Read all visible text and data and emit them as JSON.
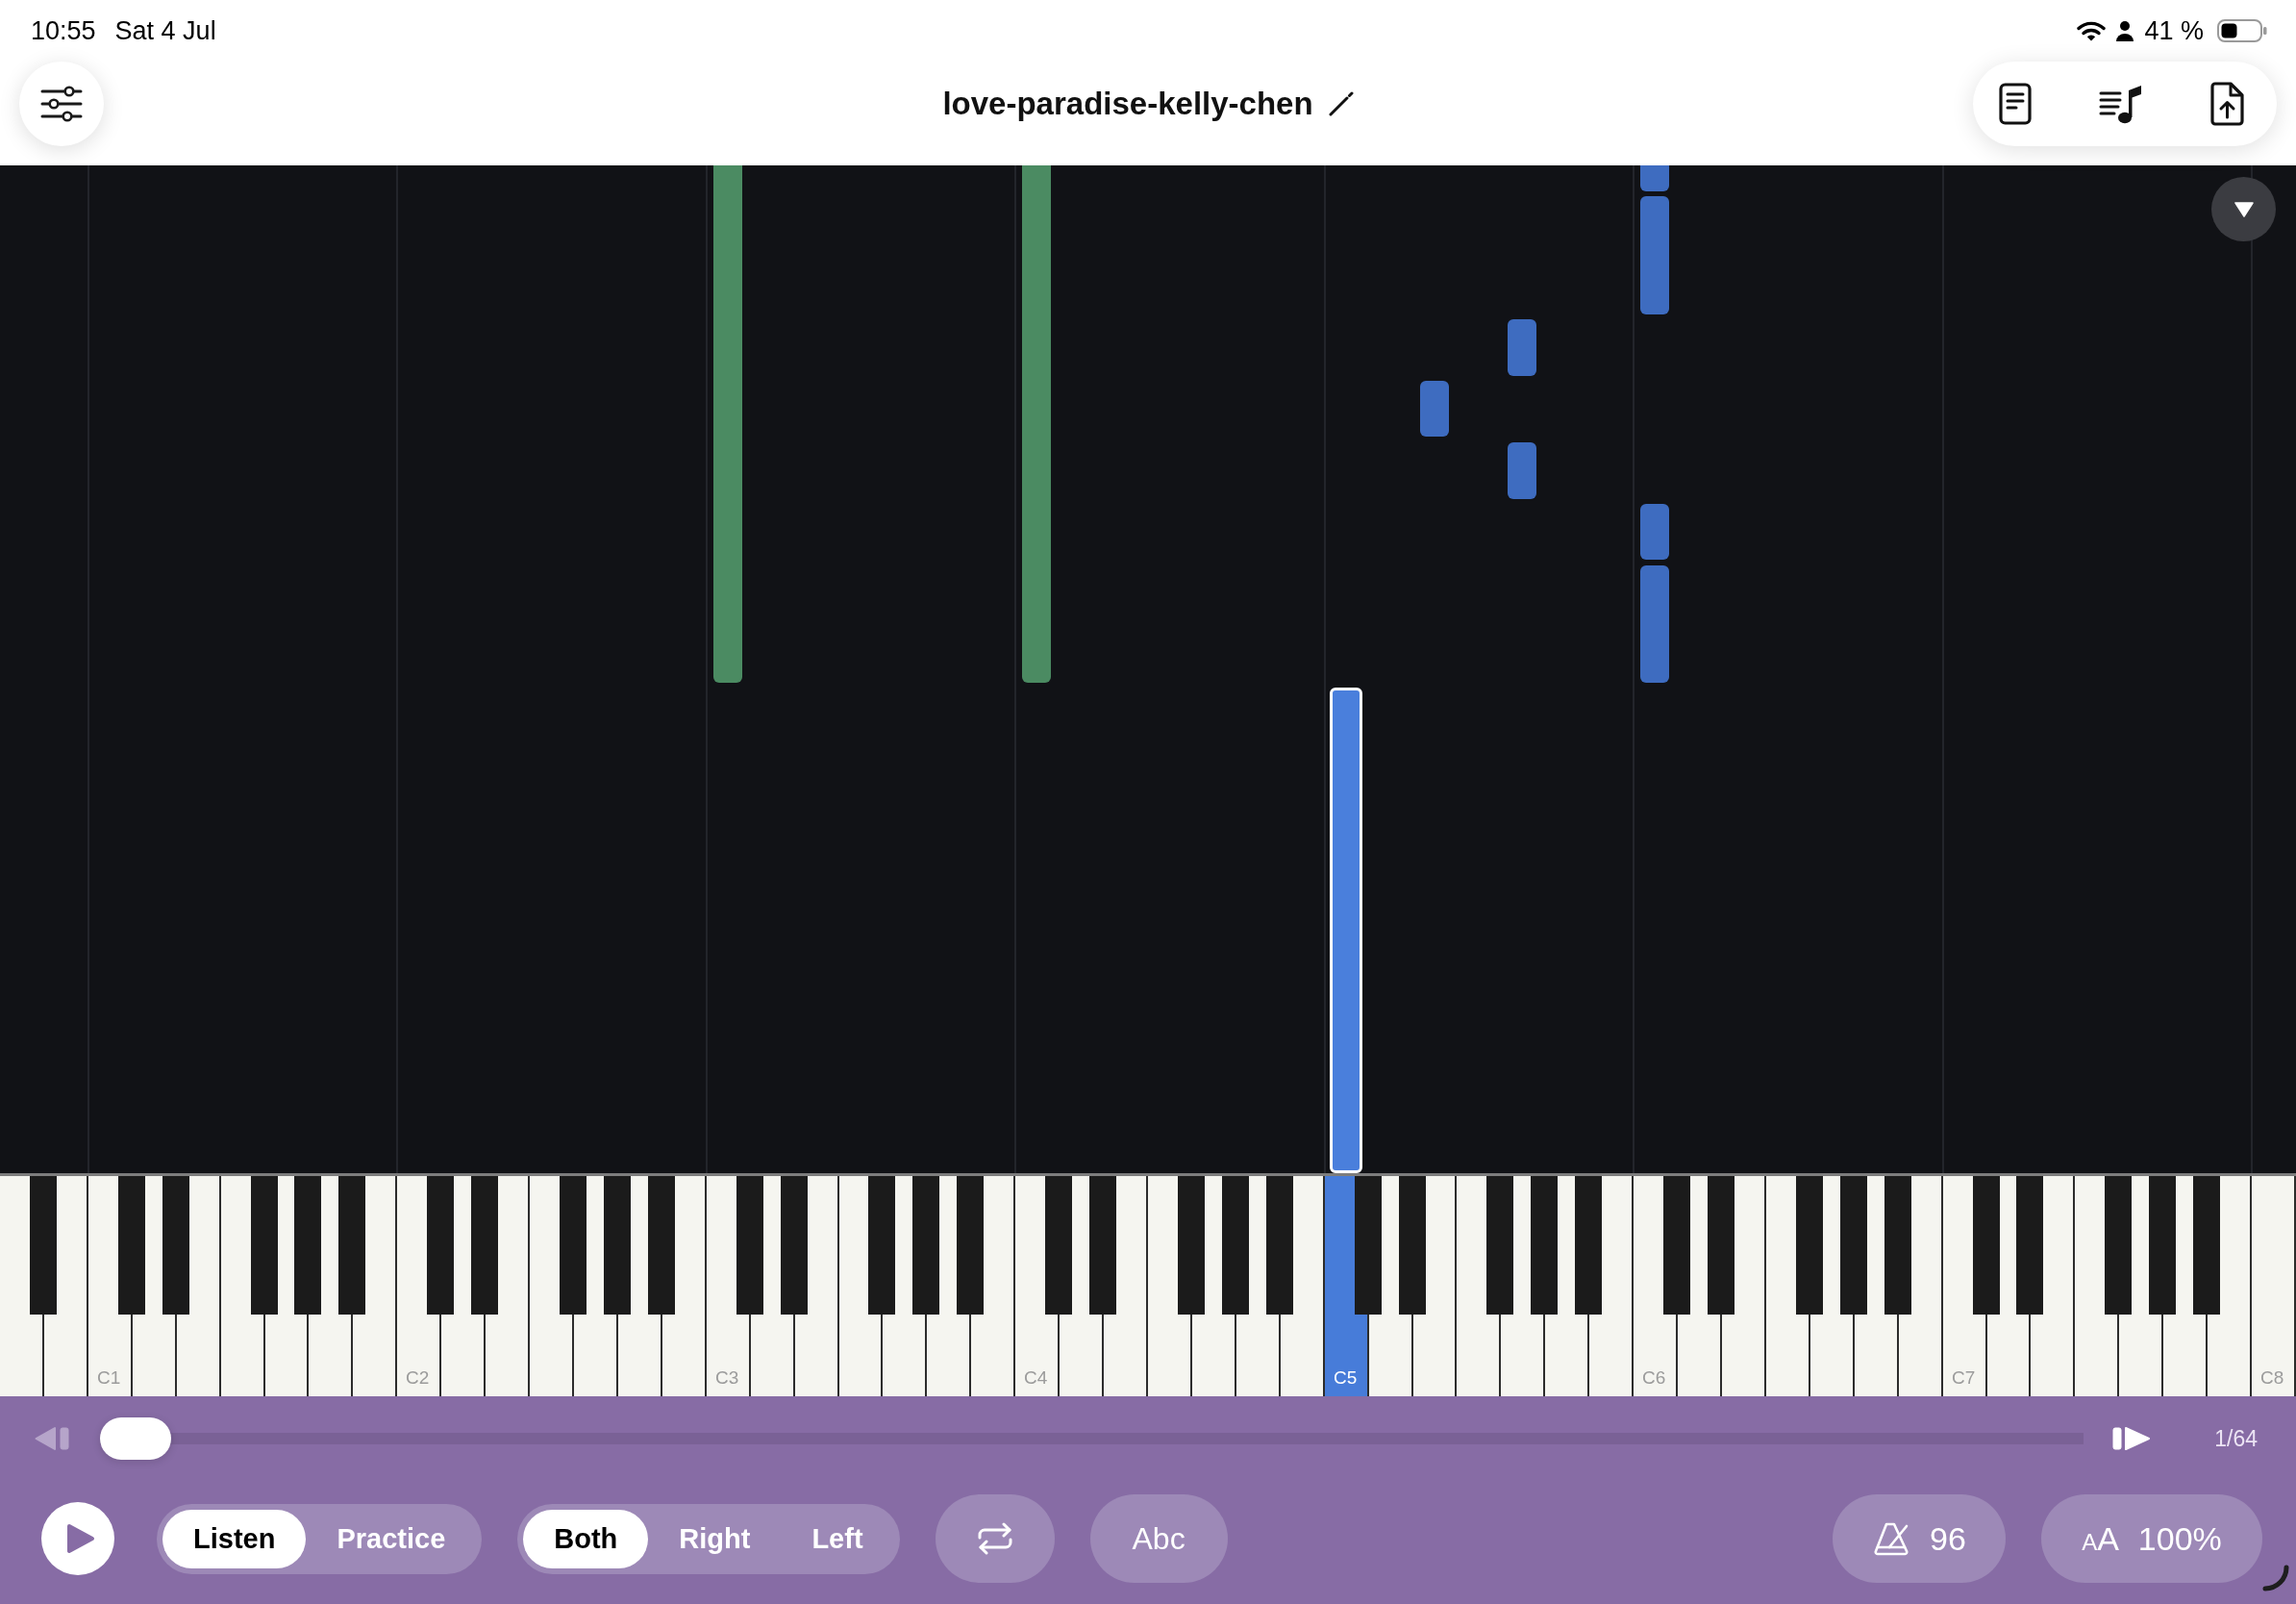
{
  "status_bar": {
    "time": "10:55",
    "date": "Sat 4 Jul",
    "battery": "41 %"
  },
  "toolbar": {
    "title": "love-paradise-kelly-chen"
  },
  "note_roll": {
    "notes": [
      {
        "color": "#4b8b62",
        "playing": false
      },
      {
        "color": "#4b8b62",
        "playing": false
      },
      {
        "color": "#4a7fdc",
        "playing": true
      },
      {
        "color": "#3e6cc0",
        "playing": false
      },
      {
        "color": "#3e6cc0",
        "playing": false
      },
      {
        "color": "#3e6cc0",
        "playing": false
      },
      {
        "color": "#3e6cc0",
        "playing": false
      },
      {
        "color": "#3e6cc0",
        "playing": false
      },
      {
        "color": "#3e6cc0",
        "playing": false
      },
      {
        "color": "#3e6cc0",
        "playing": false
      }
    ]
  },
  "keyboard": {
    "c_keys": [
      {
        "label": "C1",
        "pressed": false
      },
      {
        "label": "C2",
        "pressed": false
      },
      {
        "label": "C3",
        "pressed": false
      },
      {
        "label": "C4",
        "pressed": false
      },
      {
        "label": "C5",
        "pressed": true
      },
      {
        "label": "C6",
        "pressed": false
      },
      {
        "label": "C7",
        "pressed": false
      },
      {
        "label": "C8",
        "pressed": false
      }
    ]
  },
  "transport": {
    "previous": {
      "disabled": true
    },
    "progress": {
      "level": 0
    },
    "next": {
      "disabled": false
    },
    "counter": "1/64"
  },
  "controls": {
    "mode_tabs": [
      {
        "label": "Listen",
        "selected": true
      },
      {
        "label": "Practice",
        "selected": false
      }
    ],
    "hand_tabs": [
      {
        "label": "Both",
        "selected": true
      },
      {
        "label": "Right",
        "selected": false
      },
      {
        "label": "Left",
        "selected": false
      }
    ],
    "labels_button": "Abc",
    "tempo": "96",
    "zoom": {
      "symbol": "AA",
      "value": "100%"
    }
  }
}
